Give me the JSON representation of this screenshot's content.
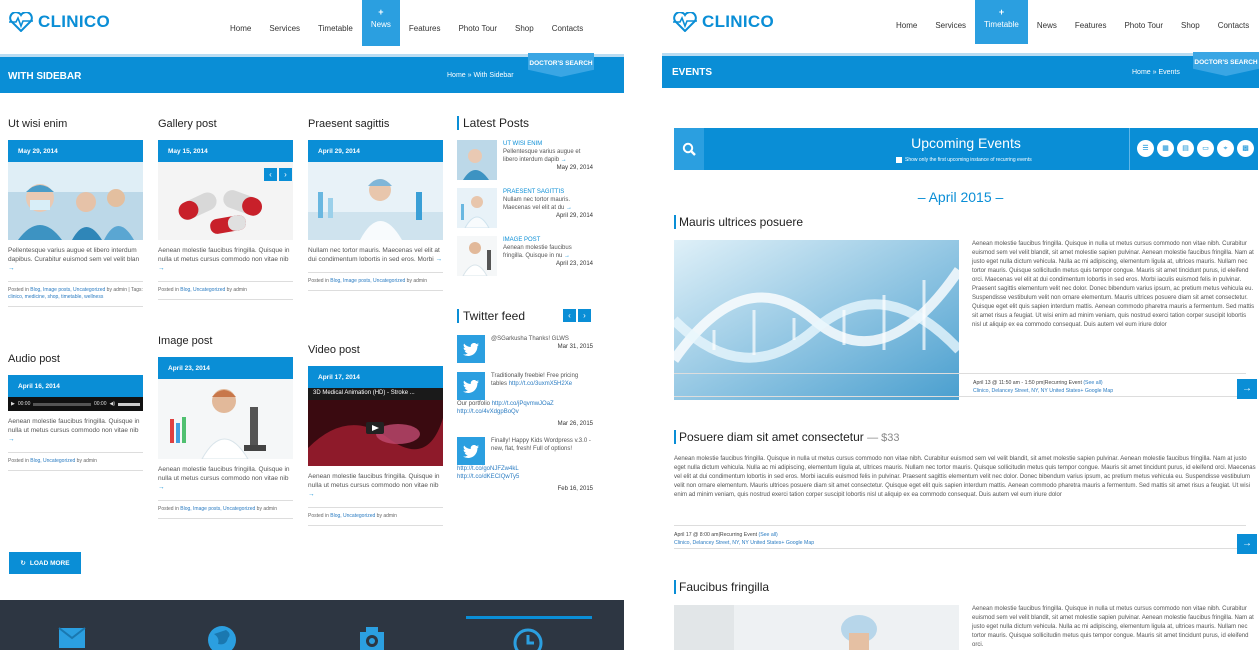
{
  "left": {
    "brand": "CLINICO",
    "nav": [
      {
        "label": "Home"
      },
      {
        "label": "Services"
      },
      {
        "label": "Timetable"
      },
      {
        "label": "News",
        "active": true
      },
      {
        "label": "Features"
      },
      {
        "label": "Photo Tour"
      },
      {
        "label": "Shop"
      },
      {
        "label": "Contacts"
      }
    ],
    "bar_title": "WITH SIDEBAR",
    "breadcrumb": "Home » With Sidebar",
    "doctors_search": "DOCTOR'S SEARCH",
    "posts": [
      {
        "title": "Ut wisi enim",
        "date": "May 29, 2014",
        "excerpt": "Pellentesque varius augue et libero interdum dapibus. Curabitur euismod sem vel velit blan",
        "arrow": "→",
        "meta_prefix": "Posted in ",
        "meta_links": "Blog, Image posts, Uncategorized",
        "meta_by": " by admin | Tags: ",
        "meta_tags": "clinico, medicine, shop, timetable, wellness"
      },
      {
        "title": "Gallery post",
        "date": "May 15, 2014",
        "excerpt": "Aenean molestie faucibus fringilla. Quisque in nulla ut metus cursus commodo non vitae nib",
        "arrow": "→",
        "meta_prefix": "Posted in ",
        "meta_links": "Blog, Uncategorized",
        "meta_by": " by admin"
      },
      {
        "title": "Praesent sagittis",
        "date": "April 29, 2014",
        "excerpt": "Nullam nec tortor mauris. Maecenas vel elit at dui condimentum lobortis in sed eros. Morbi",
        "arrow": "→",
        "meta_prefix": "Posted in ",
        "meta_links": "Blog, Image posts, Uncategorized",
        "meta_by": " by admin"
      },
      {
        "title": "Audio post",
        "date": "April 16, 2014",
        "audio_left": "00:00",
        "audio_right": "00:00",
        "excerpt": "Aenean molestie faucibus fringilla. Quisque in nulla ut metus cursus commodo non vitae nib",
        "arrow": "→",
        "meta_prefix": "Posted in ",
        "meta_links": "Blog, Uncategorized",
        "meta_by": " by admin"
      },
      {
        "title": "Image post",
        "date": "April 23, 2014",
        "excerpt": "Aenean molestie faucibus fringilla. Quisque in nulla ut metus cursus commodo non vitae nib",
        "arrow": "→",
        "meta_prefix": "Posted in ",
        "meta_links": "Blog, Image posts, Uncategorized",
        "meta_by": " by admin"
      },
      {
        "title": "Video post",
        "date": "April 17, 2014",
        "video_title": "3D Medical Animation (HD) - Stroke ...",
        "excerpt": "Aenean molestie faucibus fringilla. Quisque in nulla ut metus cursus commodo non vitae nib",
        "arrow": "→",
        "meta_prefix": "Posted in ",
        "meta_links": "Blog, Uncategorized",
        "meta_by": " by admin"
      }
    ],
    "latest_title": "Latest Posts",
    "latest": [
      {
        "head": "UT WISI ENIM",
        "text": "Pellentesque varius augue et libero interdum dapib",
        "arrow": "→",
        "date": "May 29, 2014"
      },
      {
        "head": "PRAESENT SAGITTIS",
        "text": "Nullam nec tortor mauris. Maecenas vel elit at du",
        "arrow": "→",
        "date": "April 29, 2014"
      },
      {
        "head": "IMAGE POST",
        "text": "Aenean molestie faucibus fringilla. Quisque in nu",
        "arrow": "→",
        "date": "April 23, 2014"
      }
    ],
    "twitter_title": "Twitter feed",
    "tweets": [
      {
        "text": "@SGarkusha Thanks! GLWS",
        "link": "",
        "date": "Mar 31, 2015"
      },
      {
        "text": "Traditionally freebie! Free pricing tables",
        "link": "http://t.co/3uxmX5H2Xe",
        "text2": " Our portfolio ",
        "link2": "http://t.co/jPqvmwJOaZ",
        "link3": "http://t.co/4vXdgpBoQv",
        "date": "Mar 26, 2015"
      },
      {
        "text": "Finally! Happy Kids Wordpress v.3.0 - new, flat, fresh! Full of options!",
        "link": "http://t.co/goNJFZw4kL",
        "text2": " ",
        "link2": "http://t.co/dKECIQwTy5",
        "link3": "",
        "date": "Feb 16, 2015"
      }
    ],
    "load_more": "LOAD MORE"
  },
  "right": {
    "brand": "CLINICO",
    "nav": [
      {
        "label": "Home"
      },
      {
        "label": "Services"
      },
      {
        "label": "Timetable",
        "active": true
      },
      {
        "label": "News"
      },
      {
        "label": "Features"
      },
      {
        "label": "Photo Tour"
      },
      {
        "label": "Shop"
      },
      {
        "label": "Contacts"
      }
    ],
    "bar_title": "EVENTS",
    "breadcrumb": "Home » Events",
    "doctors_search": "DOCTOR'S SEARCH",
    "events_title": "Upcoming Events",
    "checkbox_label": "Show only the first upcoming instance of recurring events",
    "month": "– April 2015 –",
    "events": [
      {
        "title": "Mauris ultrices posuere",
        "price": "",
        "text": "Aenean molestie faucibus fringilla. Quisque in nulla ut metus cursus commodo non vitae nibh. Curabitur euismod sem vel velit blandit, sit amet molestie sapien pulvinar. Aenean molestie faucibus fringilla. Nam at justo eget nulla dictum vehicula. Nulla ac mi adipiscing, elementum ligula at, ultrices mauris. Nullam nec tortor mauris. Quisque sollicitudin metus quis tempor congue. Mauris sit amet tincidunt purus, id eleifend orci. Maecenas vel elit at dui condimentum lobortis in sed eros. Morbi iaculis euismod felis in pulvinar. Praesent sagittis elementum velit nec dolor. Donec bibendum varius ipsum, ac pretium metus vehicula eu. Suspendisse vestibulum velit non ornare elementum. Mauris ultrices posuere diam sit amet consectetur. Quisque eget elit quis sapien interdum mattis. Aenean commodo pharetra mauris a fermentum. Sed mattis sit amet risus a feugiat. Ut wisi enim ad minim veniam, quis nostrud exerci tation corper suscipit lobortis nisl ut aliquip ex ea commodo consequat. Duis autem vel eum iriure dolor",
        "when": "April 13 @ 11:50 am - 1:50 pm",
        "recurring": "|Recurring Event ",
        "see_all": "(See all)",
        "where": "Clinico, Delancey Street, NY, NY United States+ ",
        "map": "Google Map"
      },
      {
        "title": "Posuere diam sit amet consectetur",
        "price": "— $33",
        "text": "Aenean molestie faucibus fringilla. Quisque in nulla ut metus cursus commodo non vitae nibh. Curabitur euismod sem vel velit blandit, sit amet molestie sapien pulvinar. Aenean molestie faucibus fringilla. Nam at justo eget nulla dictum vehicula. Nulla ac mi adipiscing, elementum ligula at, ultrices mauris. Nullam nec tortor mauris. Quisque sollicitudin metus quis tempor congue. Mauris sit amet tincidunt purus, id eleifend orci. Maecenas vel elit at dui condimentum lobortis in sed eros. Morbi iaculis euismod felis in pulvinar. Praesent sagittis elementum velit nec dolor. Donec bibendum varius ipsum, ac pretium metus vehicula eu. Suspendisse vestibulum velit non ornare elementum. Mauris ultrices posuere diam sit amet consectetur. Quisque eget elit quis sapien interdum mattis. Aenean commodo pharetra mauris a fermentum. Sed mattis sit amet risus a feugiat. Ut wisi enim ad minim veniam, quis nostrud exerci tation corper suscipit lobortis nisl ut aliquip ex ea commodo consequat. Duis autem vel eum iriure dolor",
        "when": "April 17 @ 8:00 am",
        "recurring": "|Recurring Event ",
        "see_all": "(See all)",
        "where": "Clinico, Delancey Street, NY, NY United States+ ",
        "map": "Google Map"
      },
      {
        "title": "Faucibus fringilla",
        "price": "",
        "text": "Aenean molestie faucibus fringilla. Quisque in nulla ut metus cursus commodo non vitae nibh. Curabitur euismod sem vel velit blandit, sit amet molestie sapien pulvinar. Aenean molestie faucibus fringilla. Nam at justo eget nulla dictum vehicula. Nulla ac mi adipiscing, elementum ligula at, ultrices mauris. Nullam nec tortor mauris. Quisque sollicitudin metus quis tempor congue. Mauris sit amet tincidunt purus, id eleifend orci."
      }
    ]
  }
}
